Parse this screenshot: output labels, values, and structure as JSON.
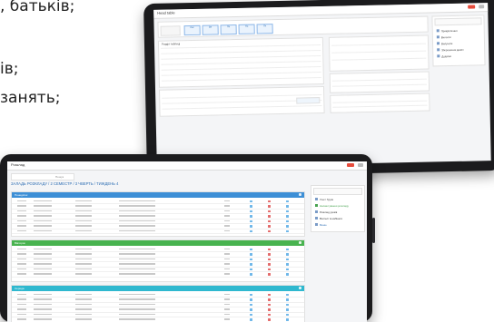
{
  "slide": {
    "line1": ", батьків;",
    "line2": "ів;",
    "line3": "занять;"
  },
  "back_tablet": {
    "window_title": "Head table",
    "tabs": [
      "Лес",
      "Ве",
      "Пе",
      "Пя",
      "Пк"
    ],
    "left_panel_title": "Розділ таблиці",
    "side_items": [
      "Прикріплення",
      "Вносити",
      "Вилучити",
      "Збереження даних",
      "Додатки"
    ]
  },
  "front_tablet": {
    "window_title": "Розклад",
    "heading": "ЗАЛАДЬ РОЗКЛАДУ / 2 СЕМЕСТР / 3 ЧВЕРТЬ / ТИЖДЕНЬ 4",
    "filter_placeholder": "Пошук",
    "side_items": [
      "Учні / Групи",
      "Налаштування розкладу",
      "Розклад уроків",
      "Вчителі та кабінети",
      "Меню"
    ],
    "sections": [
      {
        "label": "Понеділок",
        "color": "#3d8fd6"
      },
      {
        "label": "Вівторок",
        "color": "#48b34f"
      },
      {
        "label": "Середа",
        "color": "#2fb8cf"
      }
    ]
  }
}
